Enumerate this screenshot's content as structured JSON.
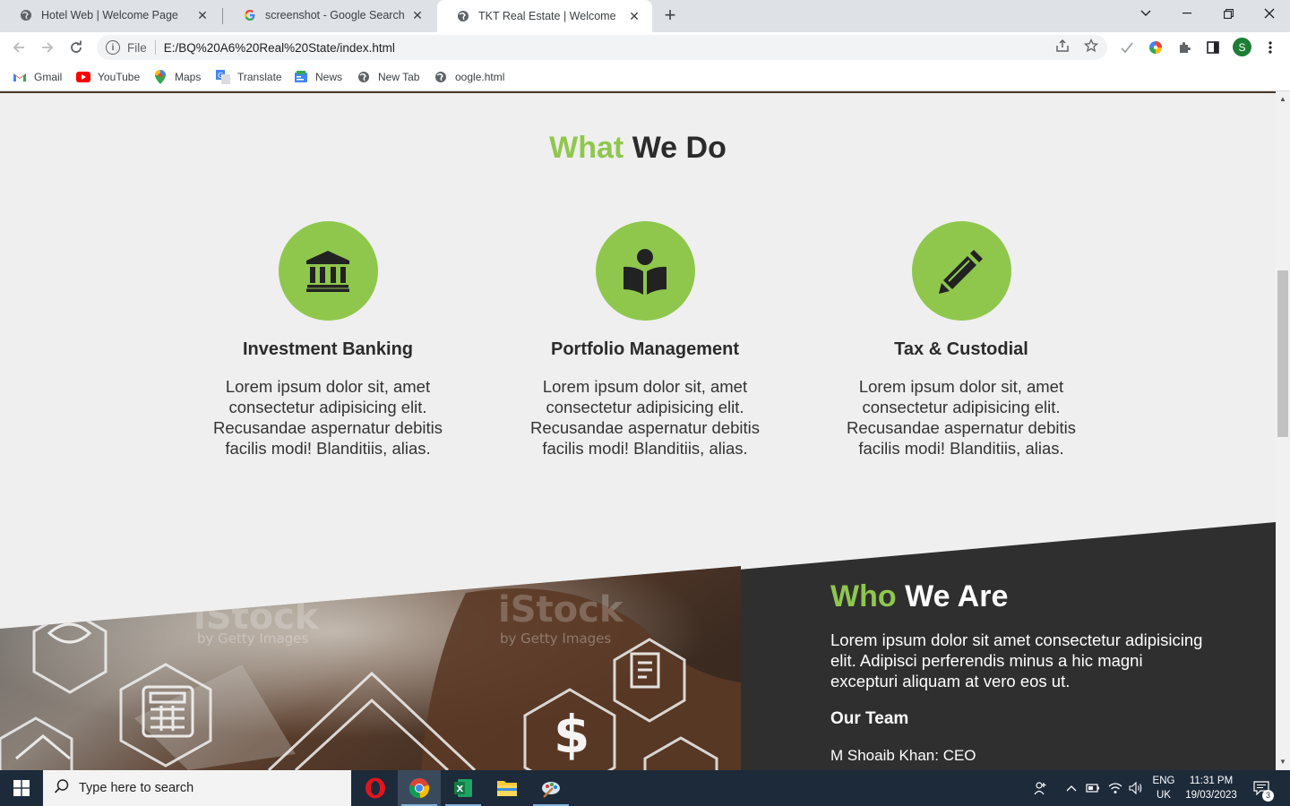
{
  "browser": {
    "tabs": [
      {
        "title": "Hotel Web | Welcome Page",
        "active": false
      },
      {
        "title": "screenshot - Google Search",
        "active": false
      },
      {
        "title": "TKT Real Estate | Welcome",
        "active": true
      }
    ],
    "address": {
      "scheme": "File",
      "url": "E:/BQ%20A6%20Real%20State/index.html"
    },
    "bookmarks": [
      "Gmail",
      "YouTube",
      "Maps",
      "Translate",
      "News",
      "New Tab",
      "oogle.html"
    ],
    "profile_initial": "S"
  },
  "page": {
    "what_we_do": {
      "title_accent": "What",
      "title_rest": "We Do",
      "services": [
        {
          "icon": "bank-icon",
          "title": "Investment Banking",
          "text": "Lorem ipsum dolor sit, amet consectetur adipisicing elit. Recusandae aspernatur debitis facilis modi! Blanditiis, alias."
        },
        {
          "icon": "book-reader-icon",
          "title": "Portfolio Management",
          "text": "Lorem ipsum dolor sit, amet consectetur adipisicing elit. Recusandae aspernatur debitis facilis modi! Blanditiis, alias."
        },
        {
          "icon": "pencil-icon",
          "title": "Tax & Custodial",
          "text": "Lorem ipsum dolor sit, amet consectetur adipisicing elit. Recusandae aspernatur debitis facilis modi! Blanditiis, alias."
        }
      ]
    },
    "who_we_are": {
      "title_accent": "Who",
      "title_rest": "We Are",
      "text": "Lorem ipsum dolor sit amet consectetur adipisicing elit. Adipisci perferendis minus a hic magni excepturi aliquam at vero eos ut.",
      "team_heading": "Our Team",
      "first_member": "M Shoaib Khan: CEO"
    },
    "image_watermarks": [
      "iStock",
      "by Getty Images"
    ]
  },
  "taskbar": {
    "search_placeholder": "Type here to search",
    "lang_top": "ENG",
    "lang_bottom": "UK",
    "time": "11:31 PM",
    "date": "19/03/2023",
    "notification_count": "3"
  },
  "colors": {
    "accent": "#8fc74d",
    "dark_section": "#2f2f2f",
    "page_bg": "#efefef"
  }
}
